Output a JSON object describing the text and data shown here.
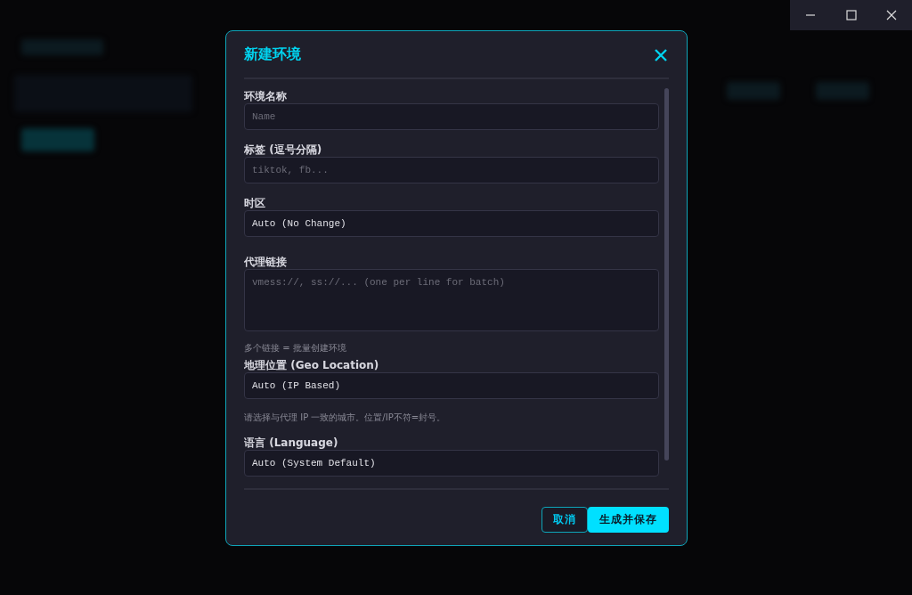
{
  "window_controls": [
    {
      "kind": "minimize"
    },
    {
      "kind": "maximize"
    },
    {
      "kind": "close"
    }
  ],
  "dialog": {
    "title": "新建环境",
    "fields": [
      {
        "kind": "input",
        "label": "环境名称",
        "placeholder": "Name"
      },
      {
        "kind": "input",
        "label": "标签 (逗号分隔)",
        "placeholder": "tiktok, fb..."
      },
      {
        "kind": "select",
        "label": "时区",
        "value": "Auto (No Change)"
      },
      {
        "kind": "textarea",
        "label": "代理链接",
        "placeholder": "vmess://, ss://... (one per line for batch)",
        "hint": "多个链接 = 批量创建环境"
      },
      {
        "kind": "select",
        "label": "地理位置 (Geo Location)",
        "value": "Auto (IP Based)",
        "hint": "请选择与代理 IP 一致的城市。位置/IP不符=封号。"
      },
      {
        "kind": "select",
        "label": "语言 (Language)",
        "value": "Auto (System Default)"
      }
    ],
    "buttons": [
      {
        "kind": "secondary",
        "label": "取消"
      },
      {
        "kind": "primary",
        "label": "生成并保存"
      }
    ]
  }
}
